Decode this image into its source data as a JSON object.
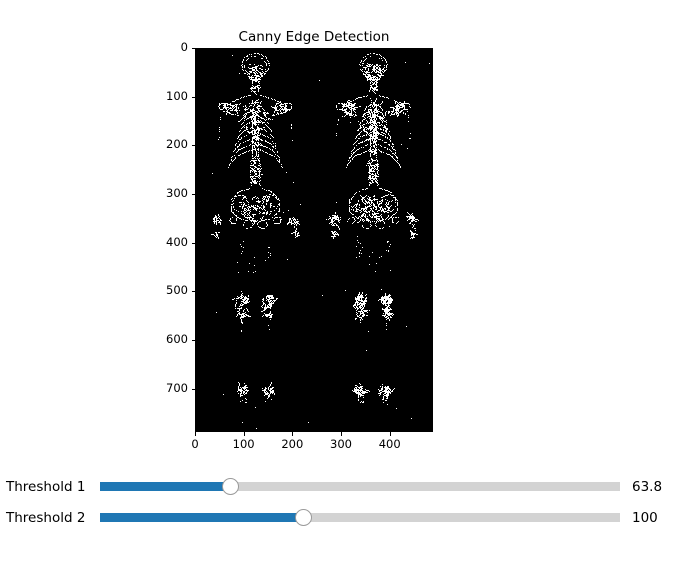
{
  "figure": {
    "title": "Canny Edge Detection",
    "background": "#ffffff",
    "image_background": "#000000",
    "edge_color": "#ffffff",
    "content_description": "binary edge map of a whole-body bone scintigraphy scan showing anterior and posterior skeleton views"
  },
  "chart_data": {
    "type": "heatmap",
    "title": "Canny Edge Detection",
    "xlabel": "",
    "ylabel": "",
    "xlim": [
      0,
      489
    ],
    "ylim": [
      789,
      0
    ],
    "grid": false,
    "legend": null,
    "x_ticks": [
      0,
      100,
      200,
      300,
      400
    ],
    "x_tick_labels": [
      "0",
      "100",
      "200",
      "300",
      "400"
    ],
    "y_ticks": [
      0,
      100,
      200,
      300,
      400,
      500,
      600,
      700
    ],
    "y_tick_labels": [
      "0",
      "100",
      "200",
      "300",
      "400",
      "500",
      "600",
      "700"
    ],
    "colormap": "gray",
    "value_range": [
      0,
      255
    ],
    "description": "Canny edge detection result of a dual-view whole body bone scan; white edge pixels on black background"
  },
  "controls": {
    "sliders": [
      {
        "label": "Threshold 1",
        "value": 63.8,
        "value_text": "63.8",
        "min": 0,
        "max": 255,
        "fill_fraction": 0.2502,
        "track_color": "#d3d3d3",
        "fill_color": "#1f77b4",
        "handle_color": "#ffffff"
      },
      {
        "label": "Threshold 2",
        "value": 100,
        "value_text": "100",
        "min": 0,
        "max": 255,
        "fill_fraction": 0.3922,
        "track_color": "#d3d3d3",
        "fill_color": "#1f77b4",
        "handle_color": "#ffffff"
      }
    ]
  }
}
